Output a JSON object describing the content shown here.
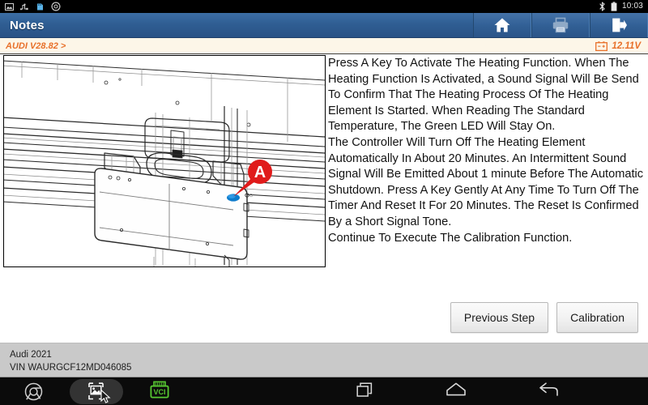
{
  "statusbar": {
    "icons_left": [
      "picture-icon",
      "usb-debug-icon",
      "sd-card-icon",
      "settings-gear-icon"
    ],
    "bluetooth_icon": "bluetooth-icon",
    "battery_icon": "battery-icon",
    "time": "10:03"
  },
  "titlebar": {
    "title": "Notes",
    "actions": [
      {
        "name": "home-button",
        "icon": "home-icon",
        "enabled": true
      },
      {
        "name": "print-button",
        "icon": "printer-icon",
        "enabled": false
      },
      {
        "name": "exit-button",
        "icon": "exit-icon",
        "enabled": true
      }
    ]
  },
  "breadcrumb": {
    "path": "AUDI V28.82 >",
    "battery_icon": "car-battery-icon",
    "voltage": "12.11V"
  },
  "figure": {
    "name": "calibration-target-diagram",
    "callout_label": "A",
    "description": "Line drawing of ADAS calibration target panel mounted on a rail frame with callout A pointing at a blue key/button"
  },
  "notes": {
    "body": "Press A Key To Activate The Heating Function. When The Heating Function Is Activated, a Sound Signal Will Be Send To Confirm That The Heating Process Of The Heating Element Is Started. When Reading The Standard Temperature, The Green LED Will Stay On.\nThe Controller Will Turn Off The Heating Element Automatically In About 20 Minutes. An Intermittent Sound Signal Will Be Emitted About 1 minute Before The Automatic Shutdown. Press A Key Gently At Any Time To Turn Off The Timer And Reset It For 20 Minutes. The Reset Is Confirmed By a Short Signal Tone.\nContinue To Execute The Calibration Function."
  },
  "buttons": {
    "previous_step": "Previous Step",
    "calibration": "Calibration"
  },
  "vehicle": {
    "make_year": "Audi  2021",
    "vin": "VIN WAURGCF12MD046085"
  },
  "navbar": {
    "left_items": [
      {
        "name": "browser-icon",
        "label": ""
      },
      {
        "name": "screenshot-icon",
        "label": ""
      },
      {
        "name": "vci-icon",
        "label": "VCI"
      }
    ],
    "right_items": [
      {
        "name": "recents-icon"
      },
      {
        "name": "home-nav-icon"
      },
      {
        "name": "back-icon"
      }
    ]
  },
  "colors": {
    "titlebar": "#2f5d92",
    "accent_orange": "#e8702a",
    "crumb_bg": "#fdf6e8",
    "footer_gray": "#c9c9c9",
    "callout_red": "#e01b1b",
    "vci_green": "#57c832"
  }
}
